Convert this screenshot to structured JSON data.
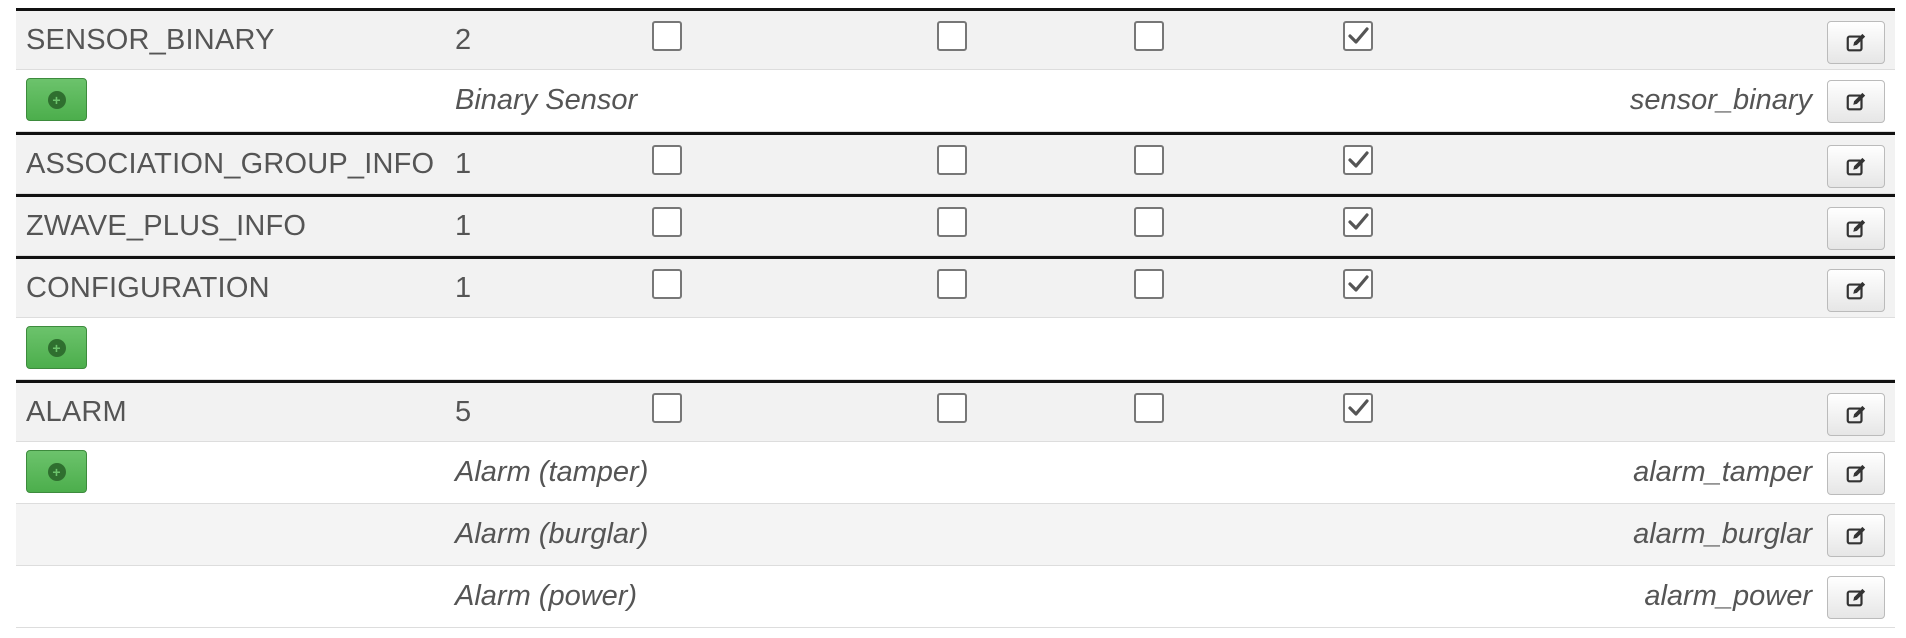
{
  "rows": [
    {
      "type": "class",
      "name": "SENSOR_BINARY",
      "version": "2",
      "checks": [
        false,
        false,
        false,
        true
      ]
    },
    {
      "type": "channel",
      "label": "Binary Sensor",
      "id": "sensor_binary",
      "add": true
    },
    {
      "type": "class",
      "name": "ASSOCIATION_GROUP_INFO",
      "version": "1",
      "checks": [
        false,
        false,
        false,
        true
      ]
    },
    {
      "type": "class",
      "name": "ZWAVE_PLUS_INFO",
      "version": "1",
      "checks": [
        false,
        false,
        false,
        true
      ]
    },
    {
      "type": "class",
      "name": "CONFIGURATION",
      "version": "1",
      "checks": [
        false,
        false,
        false,
        true
      ]
    },
    {
      "type": "channel",
      "label": "",
      "id": "",
      "add": true,
      "no_edit": true
    },
    {
      "type": "class",
      "name": "ALARM",
      "version": "5",
      "checks": [
        false,
        false,
        false,
        true
      ]
    },
    {
      "type": "channel",
      "label": "Alarm (tamper)",
      "id": "alarm_tamper",
      "add": true
    },
    {
      "type": "channel",
      "label": "Alarm (burglar)",
      "id": "alarm_burglar",
      "add": false,
      "alt": true
    },
    {
      "type": "channel",
      "label": "Alarm (power)",
      "id": "alarm_power",
      "add": false
    }
  ],
  "icons": {
    "edit": "edit-icon",
    "add": "add-icon",
    "check": "check-icon"
  },
  "colors": {
    "add_button": "#5cb85c",
    "class_row_bg": "#f2f2f2",
    "separator": "#111111"
  }
}
